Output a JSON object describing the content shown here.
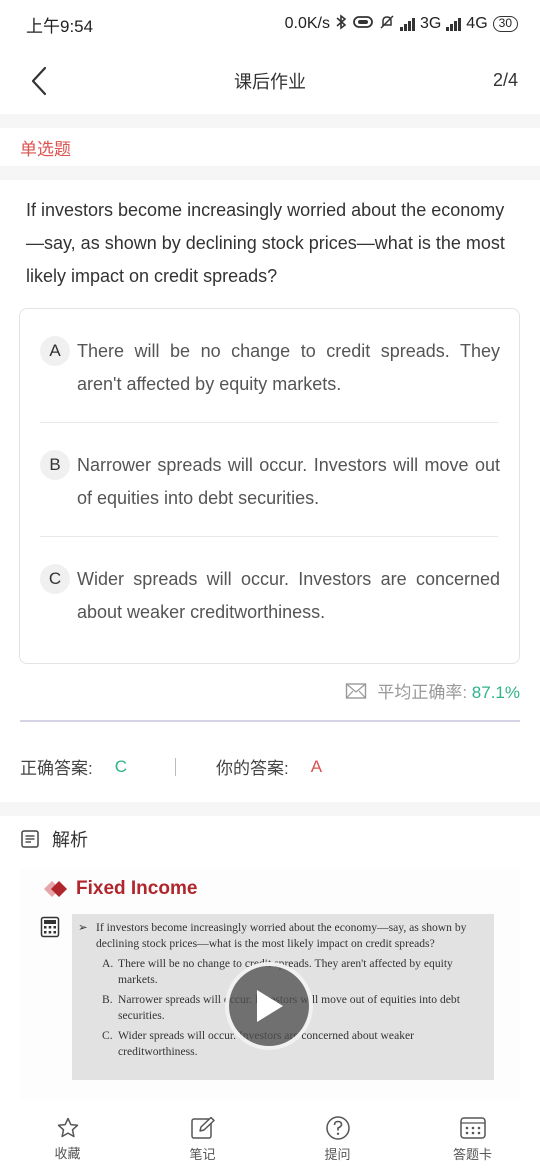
{
  "status_bar": {
    "time": "上午9:54",
    "network_speed": "0.0K/s",
    "net_3g": "3G",
    "net_4g": "4G",
    "battery": "30",
    "icons": [
      "bluetooth-icon",
      "vibrate-icon",
      "mute-icon",
      "signal-icon"
    ]
  },
  "nav": {
    "title": "课后作业",
    "progress": "2/4"
  },
  "question": {
    "type": "单选题",
    "text": "If investors become increasingly worried about the economy—say, as shown by declining stock prices—what is the most likely impact on credit spreads?",
    "options": [
      {
        "letter": "A",
        "text": "There will be no change to credit spreads. They aren't affected by equity markets."
      },
      {
        "letter": "B",
        "text": "Narrower spreads will occur. Investors will move out of equities into debt securities."
      },
      {
        "letter": "C",
        "text": "Wider spreads will occur. Investors are concerned about weaker creditworthiness."
      }
    ]
  },
  "stats": {
    "accuracy_label": "平均正确率:",
    "accuracy_value": "87.1%"
  },
  "answers": {
    "correct_label": "正确答案:",
    "correct_value": "C",
    "user_label": "你的答案:",
    "user_value": "A"
  },
  "analysis": {
    "label": "解析",
    "video": {
      "slide_title": "Fixed Income",
      "slide_question": "If investors become increasingly worried about the economy—say, as shown by declining stock prices—what is the most likely impact on credit spreads?",
      "slide_options": [
        {
          "letter": "A.",
          "text": "There will be no change to credit spreads. They aren't affected by equity markets."
        },
        {
          "letter": "B.",
          "text": "Narrower spreads will occur. Investors will move out of equities into debt securities."
        },
        {
          "letter": "C.",
          "text": "Wider spreads will occur. Investors are concerned about weaker creditworthiness."
        }
      ]
    }
  },
  "tab_bar": {
    "favorite": "收藏",
    "notes": "笔记",
    "ask": "提问",
    "answer_card": "答题卡"
  },
  "colors": {
    "correct": "#2fb38a",
    "wrong": "#d9534f",
    "slide_brand": "#b0262c"
  }
}
